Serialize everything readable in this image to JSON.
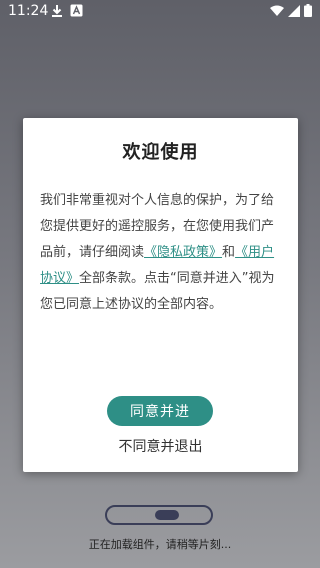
{
  "status_bar": {
    "time": "11:24",
    "icons": [
      "download-icon",
      "app-notification-icon",
      "wifi-icon",
      "signal-icon",
      "battery-icon"
    ]
  },
  "dialog": {
    "title": "欢迎使用",
    "body_part1": "我们非常重视对个人信息的保护，为了给您提供更好的遥控服务，在您使用我们产品前，请仔细阅读",
    "privacy_link": "《隐私政策》",
    "and_text": "和",
    "terms_link": "《用户协议》",
    "body_part2": "全部条款。点击“同意并进入”视为您已同意上述协议的全部内容。",
    "agree_label": "同意并进",
    "disagree_label": "不同意并退出"
  },
  "loading": {
    "text": "正在加载组件，请稍等片刻..."
  },
  "colors": {
    "accent": "#2e8f86",
    "loader": "#3a3e58"
  }
}
